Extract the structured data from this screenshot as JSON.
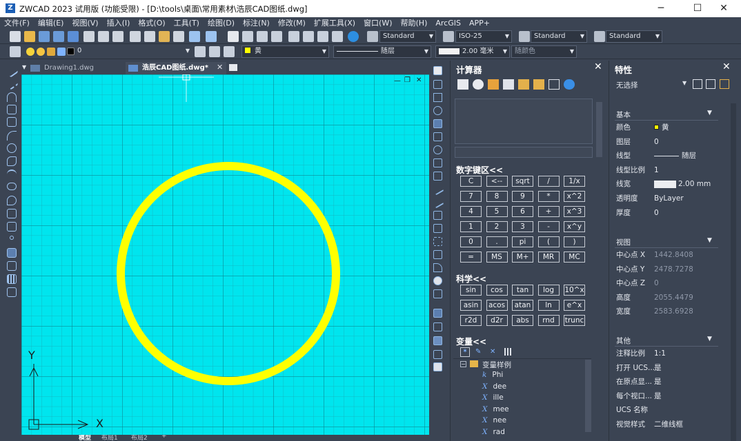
{
  "window": {
    "title": "ZWCAD 2023 试用版 (功能受限) - [D:\\tools\\桌面\\常用素材\\浩辰CAD图纸.dwg]",
    "minimize": "─",
    "maximize": "☐",
    "close": "✕"
  },
  "menu": [
    "文件(F)",
    "编辑(E)",
    "视图(V)",
    "插入(I)",
    "格式(O)",
    "工具(T)",
    "绘图(D)",
    "标注(N)",
    "修改(M)",
    "扩展工具(X)",
    "窗口(W)",
    "帮助(H)",
    "ArcGIS",
    "APP+"
  ],
  "toolbar": {
    "text_style": "Standard",
    "dim_style": "ISO-25",
    "table_style": "Standard",
    "multileader_style": "Standard"
  },
  "layerbar": {
    "layer_name": "0",
    "color": "黄",
    "linetype": "随层",
    "lineweight": "2.00 毫米",
    "plotstyle": "随颜色"
  },
  "doc_tabs": [
    {
      "label": "Drawing1.dwg",
      "active": false
    },
    {
      "label": "浩辰CAD图纸.dwg*",
      "active": true
    }
  ],
  "doc_tab_close": "✕",
  "viewport_controls": {
    "minimize": "—",
    "restore": "❐",
    "close": "✕"
  },
  "ucs": {
    "y": "Y",
    "x": "X"
  },
  "layout_tabs": [
    "模型",
    "布局1",
    "布局2",
    "+"
  ],
  "calculator": {
    "title": "计算器",
    "close": "✕",
    "numpad_title": "数字键区<<",
    "numpad": [
      "C",
      "<--",
      "sqrt",
      "/",
      "1/x",
      "7",
      "8",
      "9",
      "*",
      "x^2",
      "4",
      "5",
      "6",
      "+",
      "x^3",
      "1",
      "2",
      "3",
      "-",
      "x^y",
      "0",
      ".",
      "pi",
      "(",
      ")",
      "=",
      "MS",
      "M+",
      "MR",
      "MC"
    ],
    "sci_title": "科学<<",
    "sci": [
      "sin",
      "cos",
      "tan",
      "log",
      "10^x",
      "asin",
      "acos",
      "atan",
      "ln",
      "e^x",
      "r2d",
      "d2r",
      "abs",
      "rnd",
      "trunc"
    ],
    "vars_title": "变量<<",
    "vars_group": "变量样例",
    "vars": [
      {
        "icon": "k",
        "name": "Phi"
      },
      {
        "icon": "X",
        "name": "dee"
      },
      {
        "icon": "X",
        "name": "ille"
      },
      {
        "icon": "X",
        "name": "mee"
      },
      {
        "icon": "X",
        "name": "nee"
      },
      {
        "icon": "X",
        "name": "rad"
      }
    ]
  },
  "properties": {
    "title": "特性",
    "close": "✕",
    "selection": "无选择",
    "groups": {
      "basic": "基本",
      "view": "视图",
      "misc": "其他"
    },
    "basic": [
      {
        "k": "颜色",
        "v": "黄"
      },
      {
        "k": "图层",
        "v": "0"
      },
      {
        "k": "线型",
        "v": "随层"
      },
      {
        "k": "线型比例",
        "v": "1"
      },
      {
        "k": "线宽",
        "v": "2.00 mm"
      },
      {
        "k": "透明度",
        "v": "ByLayer"
      },
      {
        "k": "厚度",
        "v": "0"
      }
    ],
    "view": [
      {
        "k": "中心点 X",
        "v": "1442.8408"
      },
      {
        "k": "中心点 Y",
        "v": "2478.7278"
      },
      {
        "k": "中心点 Z",
        "v": "0"
      },
      {
        "k": "高度",
        "v": "2055.4479"
      },
      {
        "k": "宽度",
        "v": "2583.6928"
      }
    ],
    "misc": [
      {
        "k": "注释比例",
        "v": "1:1"
      },
      {
        "k": "打开 UCS...",
        "v": "是"
      },
      {
        "k": "在原点显...",
        "v": "是"
      },
      {
        "k": "每个视口...",
        "v": "是"
      },
      {
        "k": "UCS 名称",
        "v": ""
      },
      {
        "k": "视觉样式",
        "v": "二维线框"
      }
    ]
  },
  "colors": {
    "canvas": "#00e5ee",
    "circle": "#ffff00",
    "panel": "#3b4453"
  }
}
